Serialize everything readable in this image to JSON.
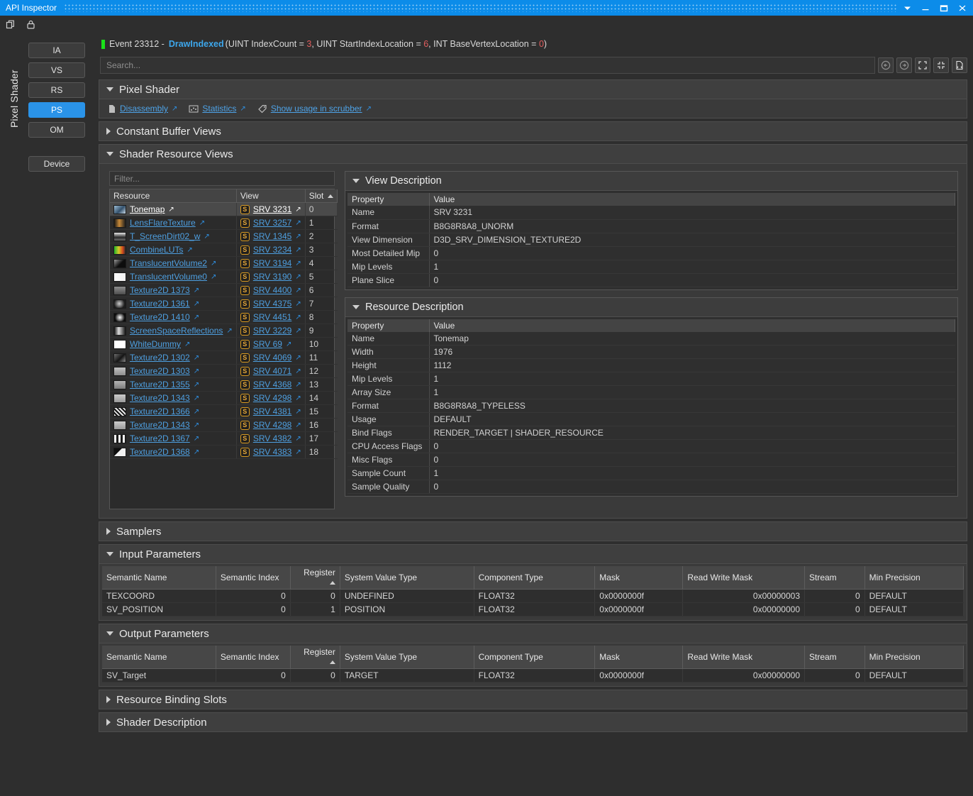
{
  "window": {
    "title": "API Inspector",
    "controls": {
      "menu": "▾",
      "minimize": "—",
      "maximize": "❐",
      "close": "✕"
    }
  },
  "toolbar": {
    "copy_icon": "copy-icon",
    "lock_icon": "lock-icon"
  },
  "sidebar": {
    "vertical_label": "Pixel Shader",
    "stages": [
      {
        "label": "IA",
        "active": false
      },
      {
        "label": "VS",
        "active": false
      },
      {
        "label": "RS",
        "active": false
      },
      {
        "label": "PS",
        "active": true
      },
      {
        "label": "OM",
        "active": false
      }
    ],
    "device_button": "Device"
  },
  "event": {
    "prefix": "Event 23312 - ",
    "function": "DrawIndexed",
    "open_paren": "(",
    "args": [
      {
        "name": "UINT IndexCount = ",
        "value": "3"
      },
      {
        "name": ", UINT StartIndexLocation = ",
        "value": "6"
      },
      {
        "name": ", INT BaseVertexLocation = ",
        "value": "0"
      }
    ],
    "close_paren": ")"
  },
  "search": {
    "placeholder": "Search...",
    "value": "",
    "buttons": [
      "back-icon",
      "forward-icon",
      "expand-all-icon",
      "collapse-all-icon",
      "export-file-icon"
    ]
  },
  "sections": {
    "pixel_shader": {
      "title": "Pixel Shader",
      "expanded": true,
      "links": [
        {
          "icon": "document-icon",
          "label": "Disassembly"
        },
        {
          "icon": "statistics-icon",
          "label": "Statistics"
        },
        {
          "icon": "tag-icon",
          "label": "Show usage in scrubber"
        }
      ]
    },
    "constant_buffer_views": {
      "title": "Constant Buffer Views",
      "expanded": false
    },
    "shader_resource_views": {
      "title": "Shader Resource Views",
      "expanded": true
    },
    "samplers": {
      "title": "Samplers",
      "expanded": false
    },
    "input_parameters": {
      "title": "Input Parameters",
      "expanded": true
    },
    "output_parameters": {
      "title": "Output Parameters",
      "expanded": true
    },
    "resource_binding_slots": {
      "title": "Resource Binding Slots",
      "expanded": false
    },
    "shader_description": {
      "title": "Shader Description",
      "expanded": false
    }
  },
  "resource_list": {
    "filter_placeholder": "Filter...",
    "filter_value": "",
    "columns": [
      "Resource",
      "View",
      "Slot"
    ],
    "sort_column": "Slot",
    "rows": [
      {
        "resource": "Tonemap",
        "view": "SRV 3231",
        "slot": "0",
        "selected": true,
        "thumb": "linear-gradient(135deg,#9fc0d8,#33506b 55%,#c8d8e6)"
      },
      {
        "resource": "LensFlareTexture",
        "view": "SRV 3257",
        "slot": "1",
        "selected": false,
        "thumb": "linear-gradient(90deg,#141414,#c98b3a 45%,#1b1b1b)"
      },
      {
        "resource": "T_ScreenDirt02_w",
        "view": "SRV 1345",
        "slot": "2",
        "selected": false,
        "thumb": "linear-gradient(180deg,#e8e8e8,#2a2a2a 60%,#707070)"
      },
      {
        "resource": "CombineLUTs",
        "view": "SRV 3234",
        "slot": "3",
        "selected": false,
        "thumb": "linear-gradient(90deg,#1fb32a,#d4c92a 40%,#d4481f 75%,#2b2b2b)"
      },
      {
        "resource": "TranslucentVolume2",
        "view": "SRV 3194",
        "slot": "4",
        "selected": false,
        "thumb": "linear-gradient(135deg,#9a9a9a,#0d0d0d 55%)"
      },
      {
        "resource": "TranslucentVolume0",
        "view": "SRV 3190",
        "slot": "5",
        "selected": false,
        "thumb": "linear-gradient(90deg,#ffffff,#f2f2f2)"
      },
      {
        "resource": "Texture2D 1373",
        "view": "SRV 4400",
        "slot": "6",
        "selected": false,
        "thumb": "linear-gradient(180deg,#8d8d8d,#4e4e4e)"
      },
      {
        "resource": "Texture2D 1361",
        "view": "SRV 4375",
        "slot": "7",
        "selected": false,
        "thumb": "radial-gradient(circle at 45% 45%,#cfcfcf,#1d1d1d 70%)"
      },
      {
        "resource": "Texture2D 1410",
        "view": "SRV 4451",
        "slot": "8",
        "selected": false,
        "thumb": "radial-gradient(circle at 50% 50%,#ffffff,#0c0c0c 72%)"
      },
      {
        "resource": "ScreenSpaceReflections",
        "view": "SRV 3229",
        "slot": "9",
        "selected": false,
        "thumb": "linear-gradient(90deg,#101010,#dedede 40%,#121212)"
      },
      {
        "resource": "WhiteDummy",
        "view": "SRV 69",
        "slot": "10",
        "selected": false,
        "thumb": "linear-gradient(90deg,#ffffff,#ffffff)"
      },
      {
        "resource": "Texture2D 1302",
        "view": "SRV 4069",
        "slot": "11",
        "selected": false,
        "thumb": "linear-gradient(135deg,#6d6d6d,#141414 55%,#8a8a8a)"
      },
      {
        "resource": "Texture2D 1303",
        "view": "SRV 4071",
        "slot": "12",
        "selected": false,
        "thumb": "linear-gradient(180deg,#c2c2c2,#8f8f8f)"
      },
      {
        "resource": "Texture2D 1355",
        "view": "SRV 4368",
        "slot": "13",
        "selected": false,
        "thumb": "linear-gradient(180deg,#b4b4b4,#7c7c7c)"
      },
      {
        "resource": "Texture2D 1343",
        "view": "SRV 4298",
        "slot": "14",
        "selected": false,
        "thumb": "linear-gradient(180deg,#cccccc,#9a9a9a)"
      },
      {
        "resource": "Texture2D 1366",
        "view": "SRV 4381",
        "slot": "15",
        "selected": false,
        "thumb": "repeating-linear-gradient(45deg,#e8e8e8 0 2px,#141414 2px 4px)"
      },
      {
        "resource": "Texture2D 1343",
        "view": "SRV 4298",
        "slot": "16",
        "selected": false,
        "thumb": "linear-gradient(180deg,#cccccc,#9a9a9a)"
      },
      {
        "resource": "Texture2D 1367",
        "view": "SRV 4382",
        "slot": "17",
        "selected": false,
        "thumb": "repeating-linear-gradient(90deg,#f0f0f0 0 3px,#1a1a1a 3px 6px)"
      },
      {
        "resource": "Texture2D 1368",
        "view": "SRV 4383",
        "slot": "18",
        "selected": false,
        "thumb": "linear-gradient(135deg,#0f0f0f 40%,#f2f2f2 41%)"
      }
    ]
  },
  "view_description": {
    "title": "View Description",
    "columns": [
      "Property",
      "Value"
    ],
    "rows": [
      {
        "property": "Name",
        "value": "SRV 3231"
      },
      {
        "property": "Format",
        "value": "B8G8R8A8_UNORM"
      },
      {
        "property": "View Dimension",
        "value": "D3D_SRV_DIMENSION_TEXTURE2D"
      },
      {
        "property": "Most Detailed Mip",
        "value": "0"
      },
      {
        "property": "Mip Levels",
        "value": "1"
      },
      {
        "property": "Plane Slice",
        "value": "0"
      }
    ]
  },
  "resource_description": {
    "title": "Resource Description",
    "columns": [
      "Property",
      "Value"
    ],
    "rows": [
      {
        "property": "Name",
        "value": "Tonemap"
      },
      {
        "property": "Width",
        "value": "1976"
      },
      {
        "property": "Height",
        "value": "1112"
      },
      {
        "property": "Mip Levels",
        "value": "1"
      },
      {
        "property": "Array Size",
        "value": "1"
      },
      {
        "property": "Format",
        "value": "B8G8R8A8_TYPELESS"
      },
      {
        "property": "Usage",
        "value": "DEFAULT"
      },
      {
        "property": "Bind Flags",
        "value": "RENDER_TARGET | SHADER_RESOURCE"
      },
      {
        "property": "CPU Access Flags",
        "value": "0"
      },
      {
        "property": "Misc Flags",
        "value": "0"
      },
      {
        "property": "Sample Count",
        "value": "1"
      },
      {
        "property": "Sample Quality",
        "value": "0"
      }
    ]
  },
  "input_parameters": {
    "columns": [
      "Semantic Name",
      "Semantic Index",
      "Register",
      "System Value Type",
      "Component Type",
      "Mask",
      "Read Write Mask",
      "Stream",
      "Min Precision"
    ],
    "sort_column": "Register",
    "rows": [
      {
        "semantic_name": "TEXCOORD",
        "semantic_index": "0",
        "register": "0",
        "system_value_type": "UNDEFINED",
        "component_type": "FLOAT32",
        "mask": "0x0000000f",
        "read_write_mask": "0x00000003",
        "stream": "0",
        "min_precision": "DEFAULT"
      },
      {
        "semantic_name": "SV_POSITION",
        "semantic_index": "0",
        "register": "1",
        "system_value_type": "POSITION",
        "component_type": "FLOAT32",
        "mask": "0x0000000f",
        "read_write_mask": "0x00000000",
        "stream": "0",
        "min_precision": "DEFAULT"
      }
    ]
  },
  "output_parameters": {
    "columns": [
      "Semantic Name",
      "Semantic Index",
      "Register",
      "System Value Type",
      "Component Type",
      "Mask",
      "Read Write Mask",
      "Stream",
      "Min Precision"
    ],
    "sort_column": "Register",
    "rows": [
      {
        "semantic_name": "SV_Target",
        "semantic_index": "0",
        "register": "0",
        "system_value_type": "TARGET",
        "component_type": "FLOAT32",
        "mask": "0x0000000f",
        "read_write_mask": "0x00000000",
        "stream": "0",
        "min_precision": "DEFAULT"
      }
    ]
  },
  "colors": {
    "accent": "#0c8ce9",
    "link": "#4e9fe0",
    "event_marker": "#19e219",
    "numeric": "#e05d5d",
    "badge": "#d99b22"
  }
}
